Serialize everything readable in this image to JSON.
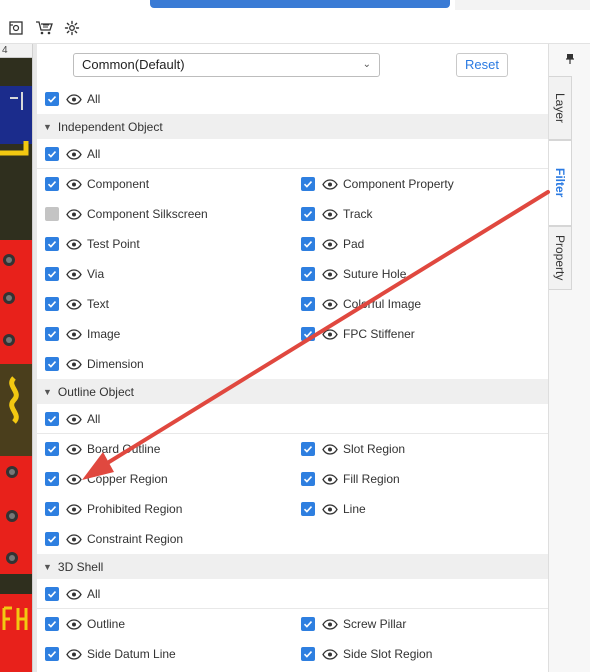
{
  "toolbar": {
    "icons": [
      "sheet-icon",
      "bom-icon",
      "gear-icon"
    ]
  },
  "ruler": {
    "label": "4"
  },
  "filter": {
    "preset_value": "Common(Default)",
    "reset_label": "Reset",
    "all_label": "All",
    "sections": [
      {
        "title": "Independent Object",
        "all_label": "All",
        "items": [
          {
            "label": "Component",
            "checked": true
          },
          {
            "label": "Component Property",
            "checked": true
          },
          {
            "label": "Component Silkscreen",
            "checked": false
          },
          {
            "label": "Track",
            "checked": true
          },
          {
            "label": "Test Point",
            "checked": true
          },
          {
            "label": "Pad",
            "checked": true
          },
          {
            "label": "Via",
            "checked": true
          },
          {
            "label": "Suture Hole",
            "checked": true
          },
          {
            "label": "Text",
            "checked": true
          },
          {
            "label": "Colorful Image",
            "checked": true
          },
          {
            "label": "Image",
            "checked": true
          },
          {
            "label": "FPC Stiffener",
            "checked": true
          },
          {
            "label": "Dimension",
            "checked": true
          }
        ]
      },
      {
        "title": "Outline Object",
        "all_label": "All",
        "items": [
          {
            "label": "Board Outline",
            "checked": true
          },
          {
            "label": "Slot Region",
            "checked": true
          },
          {
            "label": "Copper Region",
            "checked": true
          },
          {
            "label": "Fill Region",
            "checked": true
          },
          {
            "label": "Prohibited Region",
            "checked": true
          },
          {
            "label": "Line",
            "checked": true
          },
          {
            "label": "Constraint Region",
            "checked": true
          }
        ]
      },
      {
        "title": "3D Shell",
        "all_label": "All",
        "items": [
          {
            "label": "Outline",
            "checked": true
          },
          {
            "label": "Screw Pillar",
            "checked": true
          },
          {
            "label": "Side Datum Line",
            "checked": true
          },
          {
            "label": "Side Slot Region",
            "checked": true
          }
        ]
      }
    ]
  },
  "right_tabs": {
    "layer": "Layer",
    "filter": "Filter",
    "property": "Property",
    "active": "Filter"
  },
  "colors": {
    "accent": "#2e7fe0",
    "arrow": "#e0483f",
    "pcb_red": "#e8211b",
    "pcb_yellow": "#f2c811"
  }
}
